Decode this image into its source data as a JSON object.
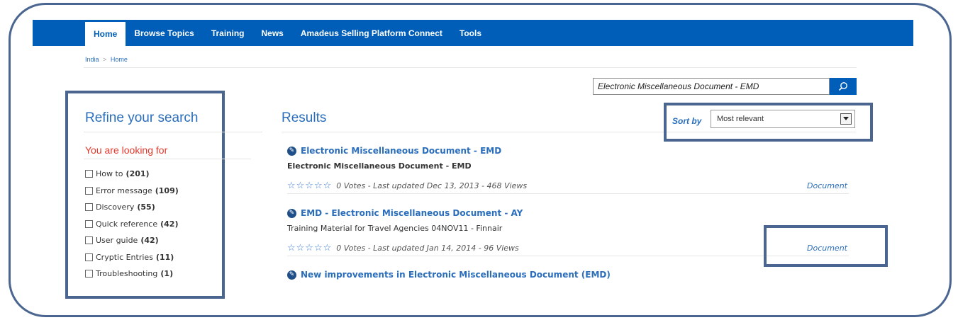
{
  "nav": {
    "items": [
      {
        "label": "Home",
        "active": true
      },
      {
        "label": "Browse Topics",
        "active": false
      },
      {
        "label": "Training",
        "active": false
      },
      {
        "label": "News",
        "active": false
      },
      {
        "label": "Amadeus Selling Platform Connect",
        "active": false
      },
      {
        "label": "Tools",
        "active": false
      }
    ]
  },
  "breadcrumb": {
    "items": [
      "India",
      "Home"
    ],
    "separator": ">"
  },
  "search": {
    "value": "Electronic Miscellaneous Document - EMD",
    "icon": "search-icon"
  },
  "refine": {
    "title": "Refine your search",
    "looking_title": "You are looking for",
    "facets": [
      {
        "label": "How to",
        "count": "(201)"
      },
      {
        "label": "Error message",
        "count": "(109)"
      },
      {
        "label": "Discovery",
        "count": "(55)"
      },
      {
        "label": "Quick reference",
        "count": "(42)"
      },
      {
        "label": "User guide",
        "count": "(42)"
      },
      {
        "label": "Cryptic Entries",
        "count": "(11)"
      },
      {
        "label": "Troubleshooting",
        "count": "(1)"
      }
    ]
  },
  "results": {
    "title": "Results",
    "sort_label": "Sort by",
    "sort_value": "Most relevant",
    "items": [
      {
        "title": "Electronic Miscellaneous Document - EMD",
        "description": "Electronic Miscellaneous Document - EMD",
        "stars": "☆☆☆☆☆",
        "meta": "0 Votes - Last updated Dec 13, 2013 - 468 Views",
        "type": "Document"
      },
      {
        "title": "EMD - Electronic Miscellaneous Document - AY",
        "description": "Training Material for Travel Agencies 04NOV11 - Finnair",
        "stars": "☆☆☆☆☆",
        "meta": "0 Votes - Last updated Jan 14, 2014 - 96 Views",
        "type": "Document"
      },
      {
        "title": "New improvements in Electronic Miscellaneous Document (EMD)"
      }
    ]
  },
  "colors": {
    "nav_bg": "#005eb8",
    "accent": "#2a6ebb",
    "highlight": "#e5372b",
    "annotation": "#4a6690"
  }
}
